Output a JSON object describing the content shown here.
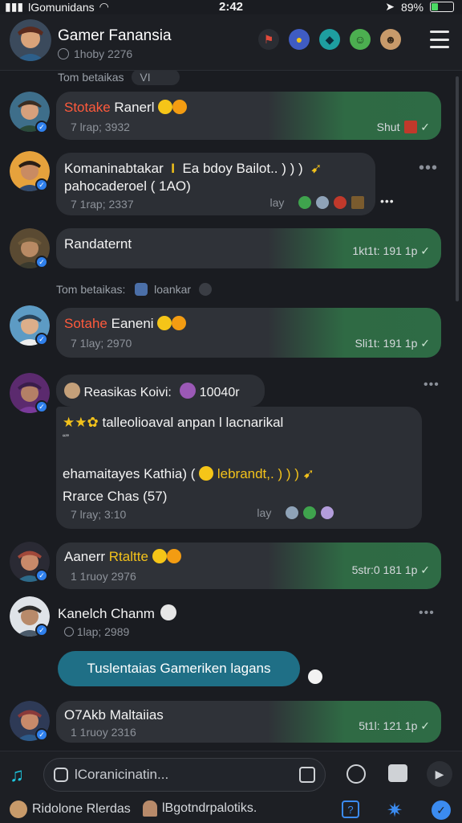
{
  "status_bar": {
    "carrier": "lGomunidans",
    "time": "2:42",
    "battery": "89%"
  },
  "header": {
    "title": "Gamer Fanansia",
    "subtitle": "1hoby 2276",
    "icons": [
      "flag-icon",
      "globe-icon",
      "shield-icon",
      "smiley-icon",
      "gamer-avatar-icon"
    ],
    "menu_icon": "hamburger-menu-icon"
  },
  "system_notes": {
    "top": "Tom betaikas",
    "top_badge": "VI",
    "mid": "Tom betaikas:",
    "mid_extra": "loankar"
  },
  "messages": [
    {
      "name_red": "Stotake",
      "name": "Ranerl",
      "time": "7 lrap; 3932",
      "right_meta": "Shut",
      "colors": {
        "bubble": "#2e6b45"
      }
    },
    {
      "line1": "Komaninabtakar",
      "line1b": "Ea bdoy Bailot.. ) ) )",
      "line2": "pahocaderoel ( 1AO)",
      "time": "7 1rap; 2337",
      "right_label": "lay",
      "dots": "•••"
    },
    {
      "name": "Randaternt",
      "right_meta": "1kt1t: 191 1p"
    },
    {
      "name_red": "Sotahe",
      "name": "Eaneni",
      "time": "7 1lay; 2970",
      "right_meta": "Sli1t: 191 1p"
    },
    {
      "header_name": "Reasikas Koivi:",
      "header_value": "10040r",
      "line1": "talleolioaval anpan l lacnarikal",
      "line1_small": "“”",
      "line2": "ehamaitayes Kathia) (",
      "line2b": "lebrandt,. ) ) )",
      "line3": "Rrarce Chas (57)",
      "time": "7 lray; 3:10",
      "right_label": "lay"
    },
    {
      "name": "Aanerr",
      "name_gold": "Rtaltte",
      "time": "1 1ruoy 2976",
      "right_meta": "5str:0 181 1p"
    },
    {
      "name": "Kanelch Chanm",
      "time": "1lap; 2989"
    },
    {
      "pill": "Tuslentaias Gameriken lagans"
    },
    {
      "name": "O7Akb Maltaiias",
      "time": "1 1ruoy 2316",
      "right_meta": "5t1l: 121 1p"
    }
  ],
  "composer": {
    "placeholder": "lCoranicinatin..."
  },
  "bottom_nav": {
    "left_label": "Ridolone Rlerdas",
    "mid_label": "lBgotndrpalotiks."
  },
  "colors": {
    "accent_green": "#2e6b45",
    "accent_blue": "#2f80ed",
    "pill_teal": "#1f6f86",
    "red_name": "#ff5a3c"
  }
}
